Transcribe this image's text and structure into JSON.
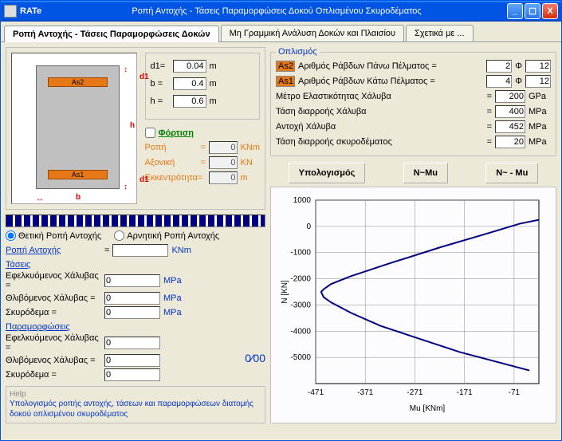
{
  "titlebar": {
    "app": "RATe",
    "subtitle": "Ροπή Αντοχής - Τάσεις Παραμορφώσεις Δοκού Οπλισμένου Σκυροδέματος"
  },
  "controls": {
    "min": "_",
    "max": "☐",
    "close": "X"
  },
  "tabs": {
    "t1": "Ροπή Αντοχής - Τάσεις Παραμορφώσεις Δοκών",
    "t2": "Μη Γραμμική Ανάλυση Δοκών και Πλαισίου",
    "t3": "Σχετικά με ..."
  },
  "diagram": {
    "as2": "As2",
    "as1": "As1",
    "h": "h",
    "b": "b",
    "d1a": "d1",
    "d1b": "d1"
  },
  "dims": {
    "d1_label": "d1=",
    "d1_val": "0.04",
    "d1_unit": "m",
    "b_label": "b =",
    "b_val": "0.4",
    "b_unit": "m",
    "h_label": "h =",
    "h_val": "0.6",
    "h_unit": "m"
  },
  "loading": {
    "title": "Φόρτιση",
    "moment_lbl": "Ροπή",
    "moment_val": "0",
    "moment_unit": "KNm",
    "axial_lbl": "Αξονική",
    "axial_val": "0",
    "axial_unit": "KN",
    "ecc_lbl": "Εκκεντρότητα=",
    "ecc_val": "0",
    "ecc_unit": "m"
  },
  "rein": {
    "legend": "Οπλισμός",
    "top_tag": "As2",
    "top_lbl": "Αριθμός Ράβδων Πάνω Πέλματος =",
    "top_n": "2",
    "phi": "Φ",
    "top_d": "12",
    "bot_tag": "As1",
    "bot_lbl": "Αριθμός Ράβδων Κάτω Πέλματος =",
    "bot_n": "4",
    "bot_d": "12"
  },
  "mat": {
    "E_lbl": "Μέτρο Ελαστικότητας Χάλυβα",
    "E_val": "200",
    "E_unit": "GPa",
    "fy_lbl": "Τάση διαρροής Χάλυβα",
    "fy_val": "400",
    "fy_unit": "MPa",
    "fu_lbl": "Αντοχή Χάλυβα",
    "fu_val": "452",
    "fu_unit": "MPa",
    "fc_lbl": "Τάση διαρροής  σκυροδέματος",
    "fc_val": "20",
    "fc_unit": "MPa",
    "eq": "="
  },
  "buttons": {
    "calc": "Υπολογισμός",
    "nmu": "N~Mu",
    "nmu2": "N~ - Mu"
  },
  "radios": {
    "pos": "Θετική Ροπή Αντοχής",
    "neg": "Αρνητική Ροπή Αντοχής"
  },
  "results": {
    "ra_lbl": "Ροπή Αντοχής",
    "ra_eq": "=",
    "ra_val": "",
    "ra_unit": "KNm",
    "stress_title": "Τάσεις",
    "ten_lbl": "Εφελκυόμενος Χάλυβας =",
    "ten_val": "0",
    "mpa": "MPa",
    "comp_lbl": "Θλιβόμενος Χάλυβας   =",
    "comp_val": "0",
    "conc_lbl": "Σκυρόδεμα                   =",
    "conc_val": "0",
    "strain_title": "Παραμορφώσεις",
    "sten_val": "0",
    "scomp_val": "0",
    "sconc_val": "0",
    "permil": "0⁄00"
  },
  "help": {
    "title": "Help",
    "text": "Υπολογισμός ροπής αντοχής, τάσεων και παραμορφώσεων διατομής δοκού οπλισμένου σκυροδέματος"
  },
  "chart_data": {
    "type": "line",
    "title": "",
    "xlabel": "Mu [KNm]",
    "ylabel": "N [KN]",
    "xlim": [
      -471,
      -21
    ],
    "ylim": [
      -6000,
      1000
    ],
    "xticks": [
      -471,
      -371,
      -271,
      -171,
      -71
    ],
    "yticks": [
      -5000,
      -4000,
      -3000,
      -2000,
      -1000,
      0,
      1000
    ],
    "series": [
      {
        "name": "envelope",
        "points": [
          [
            -21,
            250
          ],
          [
            -60,
            100
          ],
          [
            -130,
            -300
          ],
          [
            -220,
            -800
          ],
          [
            -320,
            -1400
          ],
          [
            -400,
            -1900
          ],
          [
            -440,
            -2200
          ],
          [
            -455,
            -2400
          ],
          [
            -460,
            -2500
          ],
          [
            -455,
            -2700
          ],
          [
            -440,
            -2900
          ],
          [
            -400,
            -3300
          ],
          [
            -340,
            -3800
          ],
          [
            -260,
            -4300
          ],
          [
            -180,
            -4800
          ],
          [
            -100,
            -5200
          ],
          [
            -40,
            -5500
          ]
        ]
      }
    ]
  }
}
